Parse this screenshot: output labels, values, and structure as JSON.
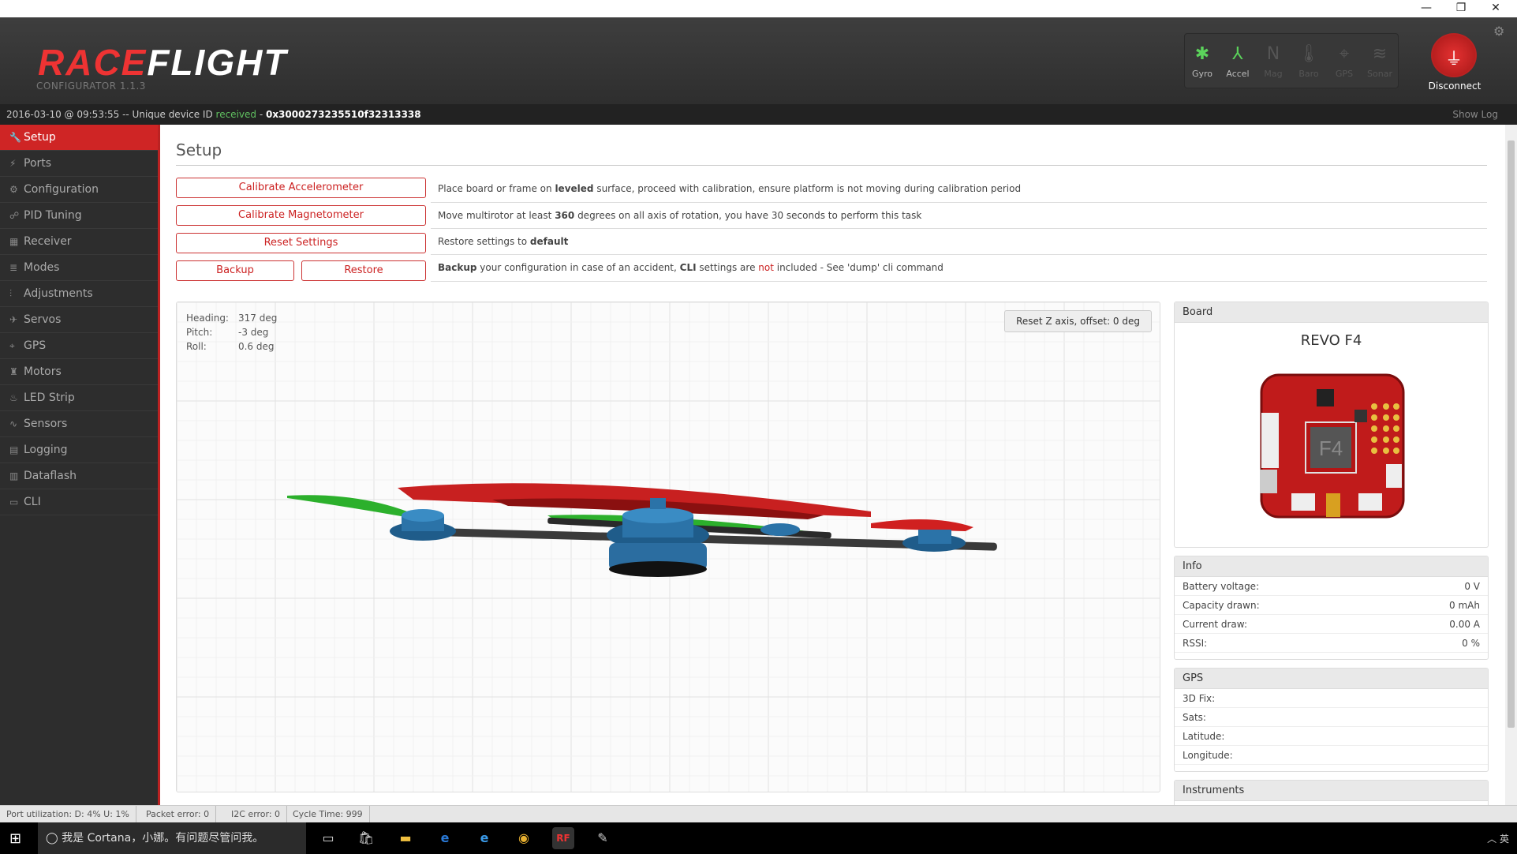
{
  "window": {
    "minimize": "—",
    "restore": "❐",
    "close": "✕"
  },
  "app": {
    "logo_race": "RACE",
    "logo_flight": "FLIGHT",
    "version": "CONFIGURATOR  1.1.3"
  },
  "sensors": [
    {
      "label": "Gyro",
      "active": true
    },
    {
      "label": "Accel",
      "active": true
    },
    {
      "label": "Mag",
      "active": false
    },
    {
      "label": "Baro",
      "active": false
    },
    {
      "label": "GPS",
      "active": false
    },
    {
      "label": "Sonar",
      "active": false
    }
  ],
  "disconnect_label": "Disconnect",
  "log": {
    "prefix": "2016-03-10 @ 09:53:55 -- Unique device ID ",
    "received": "received",
    "dash": " - ",
    "device_id": "0x3000273235510f32313338",
    "show_log": "Show Log"
  },
  "nav": [
    {
      "label": "Setup",
      "icon": "wrench-icon",
      "glyph": "🔧",
      "active": true
    },
    {
      "label": "Ports",
      "icon": "plug-icon",
      "glyph": "⚡"
    },
    {
      "label": "Configuration",
      "icon": "gear-icon",
      "glyph": "⚙"
    },
    {
      "label": "PID Tuning",
      "icon": "sitemap-icon",
      "glyph": "☍"
    },
    {
      "label": "Receiver",
      "icon": "receiver-icon",
      "glyph": "▦"
    },
    {
      "label": "Modes",
      "icon": "database-icon",
      "glyph": "≣"
    },
    {
      "label": "Adjustments",
      "icon": "sliders-icon",
      "glyph": "⫶"
    },
    {
      "label": "Servos",
      "icon": "servo-icon",
      "glyph": "✈"
    },
    {
      "label": "GPS",
      "icon": "satellite-icon",
      "glyph": "⌖"
    },
    {
      "label": "Motors",
      "icon": "motor-icon",
      "glyph": "♜"
    },
    {
      "label": "LED Strip",
      "icon": "led-icon",
      "glyph": "♨"
    },
    {
      "label": "Sensors",
      "icon": "sensor-icon",
      "glyph": "∿"
    },
    {
      "label": "Logging",
      "icon": "log-icon",
      "glyph": "▤"
    },
    {
      "label": "Dataflash",
      "icon": "chip-icon",
      "glyph": "▥"
    },
    {
      "label": "CLI",
      "icon": "terminal-icon",
      "glyph": "▭"
    }
  ],
  "setup": {
    "title": "Setup",
    "calibrate_acc": "Calibrate Accelerometer",
    "calibrate_acc_text": {
      "a": "Place board or frame on ",
      "b": "leveled",
      "c": " surface, proceed with calibration, ensure platform is not moving during calibration period"
    },
    "calibrate_mag": "Calibrate Magnetometer",
    "calibrate_mag_text": {
      "a": "Move multirotor at least ",
      "b": "360",
      "c": " degrees on all axis of rotation, you have 30 seconds to perform this task"
    },
    "reset": "Reset Settings",
    "reset_text": {
      "a": "Restore settings to ",
      "b": "default"
    },
    "backup": "Backup",
    "restore": "Restore",
    "backup_text": {
      "a": "Backup",
      "b": " your configuration in case of an accident, ",
      "c": "CLI",
      "d": " settings are ",
      "e": "not",
      "f": " included - See 'dump' cli command"
    }
  },
  "attitude": {
    "heading_label": "Heading:",
    "heading": "317 deg",
    "pitch_label": "Pitch:",
    "pitch": "-3 deg",
    "roll_label": "Roll:",
    "roll": "0.6 deg",
    "reset_z": "Reset Z axis, offset: 0 deg"
  },
  "board": {
    "title": "Board",
    "name": "REVO F4",
    "chip_label": "F4"
  },
  "info": {
    "title": "Info",
    "rows": [
      {
        "k": "Battery voltage:",
        "v": "0 V"
      },
      {
        "k": "Capacity drawn:",
        "v": "0 mAh"
      },
      {
        "k": "Current draw:",
        "v": "0.00 A"
      },
      {
        "k": "RSSI:",
        "v": "0 %"
      }
    ]
  },
  "gps": {
    "title": "GPS",
    "rows": [
      {
        "k": "3D Fix:",
        "v": ""
      },
      {
        "k": "Sats:",
        "v": ""
      },
      {
        "k": "Latitude:",
        "v": ""
      },
      {
        "k": "Longitude:",
        "v": ""
      }
    ]
  },
  "instruments": {
    "title": "Instruments"
  },
  "status": {
    "port": "Port utilization: D: 4% U: 1%",
    "packet": "Packet error: 0",
    "i2c": "I2C error: 0",
    "cycle": "Cycle Time: 999"
  },
  "taskbar": {
    "cortana": "我是 Cortana，小娜。有问题尽管问我。",
    "tray": "英"
  }
}
